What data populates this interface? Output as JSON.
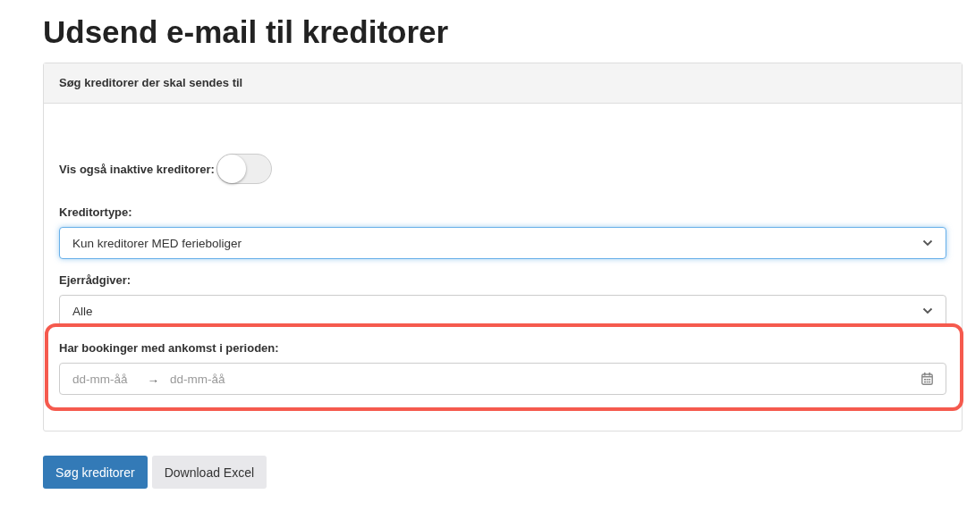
{
  "page_title": "Udsend e-mail til kreditorer",
  "panel": {
    "heading": "Søg kreditorer der skal sendes til",
    "toggle": {
      "label": "Vis også inaktive kreditorer:",
      "on": false
    },
    "fields": [
      {
        "kind": "select",
        "label": "Kreditortype:",
        "value": "Kun kreditorer MED ferieboliger",
        "focused": true
      },
      {
        "kind": "select",
        "label": "Ejerrådgiver:",
        "value": "Alle",
        "focused": false
      },
      {
        "kind": "daterange",
        "label": "Har bookinger med ankomst i perioden:",
        "start_placeholder": "dd-mm-åå",
        "separator": "→",
        "end_placeholder": "dd-mm-åå",
        "highlighted": true
      }
    ]
  },
  "buttons": [
    {
      "label": "Søg kreditorer",
      "kind": "primary"
    },
    {
      "label": "Download Excel",
      "kind": "secondary"
    }
  ]
}
